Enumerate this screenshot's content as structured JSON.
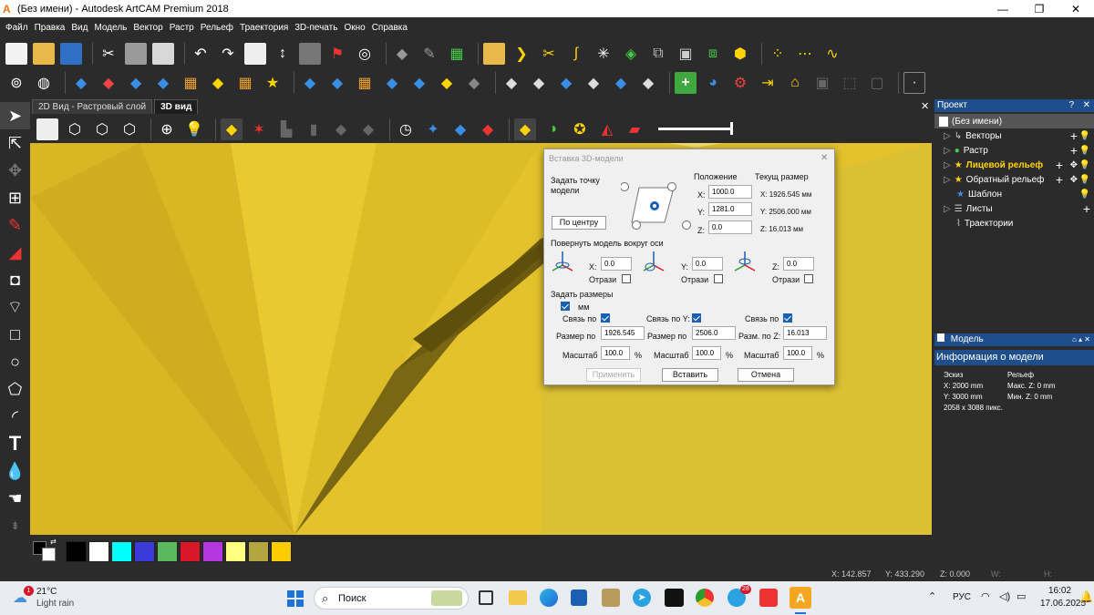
{
  "window": {
    "title": "(Без имени) - Autodesk ArtCAM Premium 2018",
    "app_icon": "A",
    "minimize": "—",
    "maximize": "❐",
    "close": "✕"
  },
  "menu": [
    "Файл",
    "Правка",
    "Вид",
    "Модель",
    "Вектор",
    "Растр",
    "Рельеф",
    "Траектория",
    "3D-печать",
    "Окно",
    "Справка"
  ],
  "tabs": [
    "2D Вид - Растровый слой",
    "3D вид"
  ],
  "viewport_close": "✕",
  "project": {
    "header": "Проект",
    "help": "?",
    "items": [
      "(Без имени)",
      "Векторы",
      "Растр",
      "Лицевой рельеф",
      "Обратный рельеф",
      "Шаблон",
      "Листы",
      "Траектории"
    ]
  },
  "model_panel": {
    "header": "Модель",
    "info_header": "Информация о модели",
    "sketch_label": "Эскиз",
    "relief_label": "Рельеф",
    "x": "X: 2000 mm",
    "y": "Y: 3000 mm",
    "max_z": "Макс. Z: 0 mm",
    "min_z": "Мин. Z: 0 mm",
    "pixels": "2058 x 3088 пикс."
  },
  "dialog": {
    "title": "Вставка 3D-модели",
    "close": "✕",
    "set_point": "Задать точку модели",
    "center_button": "По центру",
    "position": "Положение",
    "current_size": "Текущ размер",
    "pos_x_label": "X:",
    "pos_y_label": "Y:",
    "pos_z_label": "Z:",
    "pos_x": "1000.0",
    "pos_y": "1281.0",
    "pos_z": "0.0",
    "size_x": "X:  1926.545 мм",
    "size_y": "Y:  2506.000 мм",
    "size_z": "Z:  16.013 мм",
    "rotate_label": "Повернуть модель вокруг оси",
    "rot_x": "0.0",
    "rot_y": "0.0",
    "rot_z": "0.0",
    "rx_label": "X:",
    "ry_label": "Y:",
    "rz_label": "Z:",
    "mirror": "Отрази",
    "set_sizes": "Задать размеры",
    "mm": "мм",
    "link_x": "Связь по",
    "link_y": "Связь по Y:",
    "link_z": "Связь по",
    "size_x_label": "Размер по",
    "size_y_label": "Размер по",
    "size_z_label": "Разм. по Z:",
    "dim_x": "1926.545",
    "dim_y": "2506.0",
    "dim_z": "16.013",
    "scale_label": "Масштаб",
    "scale_x": "100.0",
    "scale_y": "100.0",
    "scale_z": "100.0",
    "pct": "%",
    "apply": "Применить",
    "insert": "Вставить",
    "cancel": "Отмена"
  },
  "palette": [
    "#000000",
    "#ffffff",
    "#00ffff",
    "#3b3bd9",
    "#5cb85c",
    "#d9162a",
    "#b535e0",
    "#ffff80",
    "#b3a640",
    "#ffcc00"
  ],
  "status": {
    "x": "X: 142.857",
    "y": "Y: 433.290",
    "z": "Z: 0.000",
    "w": "W:",
    "h": "H:"
  },
  "taskbar": {
    "weather_temp": "21°C",
    "weather_desc": "Light rain",
    "weather_badge": "1",
    "search": "Поиск",
    "lang": "РУС",
    "time": "16:02",
    "date": "17.06.2025",
    "tg_badge": "28"
  }
}
